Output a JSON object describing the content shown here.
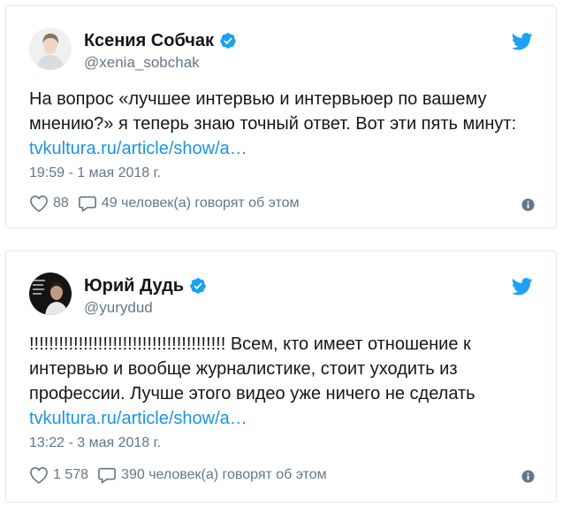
{
  "tweets": [
    {
      "author_name": "Ксения Собчак",
      "author_handle": "@xenia_sobchak",
      "text_lines": [
        "На вопрос «лучшее интервью и интервьюер по вашему",
        "мнению?» я теперь знаю точный ответ. Вот эти пять минут:"
      ],
      "link_text": "tvkultura.ru/article/show/a…",
      "timestamp": "19:59 - 1 мая 2018 г.",
      "likes": "88",
      "replies": "49 человек(а) говорят об этом"
    },
    {
      "author_name": "Юрий Дудь",
      "author_handle": "@yurydud",
      "text_lines": [
        "!!!!!!!!!!!!!!!!!!!!!!!!!!!!!!!!!!!!!!!! Всем, кто имеет отношение к",
        "интервью и вообще журналистике, стоит уходить из",
        "профессии. Лучше этого видео уже ничего не сделать"
      ],
      "link_text": "tvkultura.ru/article/show/a…",
      "timestamp": "13:22 - 3 мая 2018 г.",
      "likes": "1 578",
      "replies": "390 человек(а) говорят об этом"
    }
  ],
  "icons": {
    "verified": "verified-badge-icon",
    "twitter": "twitter-bird-icon",
    "like": "heart-icon",
    "reply": "speech-bubble-icon",
    "info": "info-icon"
  },
  "colors": {
    "twitter_blue": "#1da1f2",
    "link": "#1b95e0",
    "secondary_text": "#657786",
    "border": "#e1e8ed"
  }
}
